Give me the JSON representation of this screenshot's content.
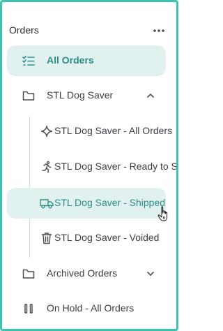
{
  "sidebar": {
    "title": "Orders",
    "more_icon": "more-horizontal-icon",
    "accent_color": "#2b8f85",
    "active_bg": "#e1f1f0",
    "items": [
      {
        "label": "All Orders",
        "icon": "checklist-icon",
        "active": true
      },
      {
        "label": "STL Dog Saver",
        "icon": "folder-icon",
        "expanded": true
      },
      {
        "label": "STL Dog Saver - All Orders",
        "icon": "sparkle-icon"
      },
      {
        "label": "STL Dog Saver - Ready to Sh",
        "icon": "running-person-icon"
      },
      {
        "label": "STL Dog Saver - Shipped",
        "icon": "truck-icon",
        "active": true
      },
      {
        "label": "STL Dog Saver - Voided",
        "icon": "trash-icon"
      },
      {
        "label": "Archived Orders",
        "icon": "folder-icon",
        "expanded": false
      },
      {
        "label": "On Hold - All Orders",
        "icon": "pause-icon"
      }
    ]
  }
}
